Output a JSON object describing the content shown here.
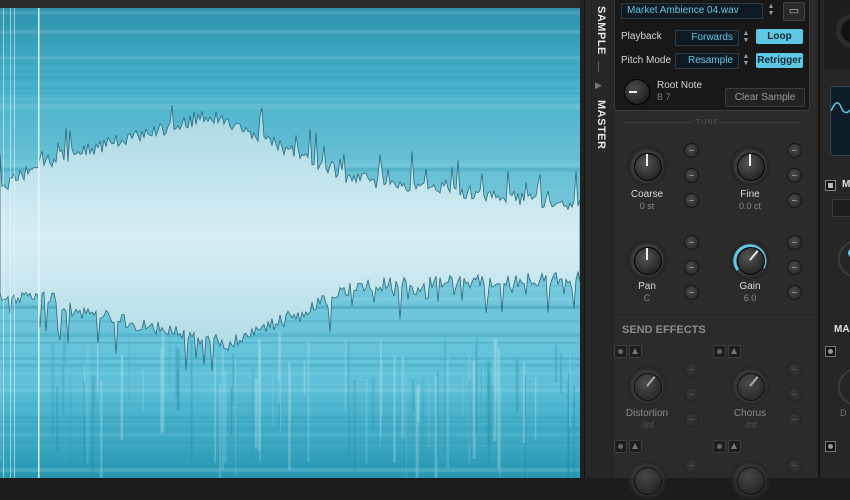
{
  "sample": {
    "filename": "Market Ambience 04.wav",
    "playback_label": "Playback",
    "playback_value": "Forwards",
    "loop_label": "Loop",
    "pitch_mode_label": "Pitch Mode",
    "pitch_mode_value": "Resample",
    "retrigger_label": "Retrigger",
    "root_note_label": "Root Note",
    "root_note_value": "B 7",
    "clear_sample_label": "Clear Sample"
  },
  "tabs": {
    "sample": "SAMPLE",
    "master": "MASTER"
  },
  "tune": {
    "section_label": "TUNE",
    "knobs": [
      {
        "name": "Coarse",
        "value": "0 st"
      },
      {
        "name": "Fine",
        "value": "0.0 ct"
      },
      {
        "name": "Pan",
        "value": "C"
      },
      {
        "name": "Gain",
        "value": "6.0"
      }
    ]
  },
  "send_effects": {
    "title": "SEND EFFECTS",
    "knobs": [
      {
        "name": "Distortion",
        "value": "-Inf"
      },
      {
        "name": "Chorus",
        "value": "-Inf"
      }
    ]
  },
  "right_panel": {
    "label_m": "M",
    "label_ma": "MA",
    "label_d": "D"
  },
  "colors": {
    "accent": "#5ec8e4",
    "waveform_bg": "#3aaec9",
    "waveform_fill": "#c8e6ee",
    "panel_bg": "#2b2b2b"
  },
  "icons": {
    "folder": "folder-icon",
    "updown": "up-down-arrow-icon"
  }
}
